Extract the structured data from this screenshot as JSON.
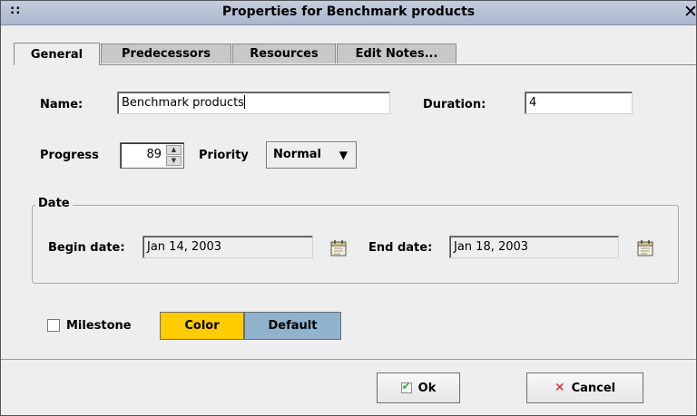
{
  "window": {
    "title": "Properties for Benchmark products",
    "grip": "::",
    "close_glyph": "✕"
  },
  "tabs": [
    {
      "label": "General",
      "active": true
    },
    {
      "label": "Predecessors",
      "active": false
    },
    {
      "label": "Resources",
      "active": false
    },
    {
      "label": "Edit Notes...",
      "active": false
    }
  ],
  "general": {
    "name_label": "Name:",
    "name_value": "Benchmark products",
    "duration_label": "Duration:",
    "duration_value": "4",
    "progress_label": "Progress",
    "progress_value": "89",
    "priority_label": "Priority",
    "priority_value": "Normal",
    "date_group_label": "Date",
    "begin_label": "Begin date:",
    "begin_value": "Jan 14, 2003",
    "end_label": "End date:",
    "end_value": "Jan 18, 2003",
    "milestone_label": "Milestone",
    "milestone_checked": false,
    "color_label": "Color",
    "default_label": "Default"
  },
  "colors": {
    "color_button": "#ffcc00",
    "default_button": "#8fb3cc"
  },
  "icons": {
    "begin_date_picker": "calendar-icon",
    "end_date_picker": "calendar-icon",
    "spinner_up": "triangle-up-icon",
    "spinner_down": "triangle-down-icon",
    "priority_dropdown": "triangle-down-icon",
    "ok": "check-icon",
    "cancel": "x-icon"
  },
  "buttons": {
    "ok_label": "Ok",
    "cancel_label": "Cancel"
  }
}
